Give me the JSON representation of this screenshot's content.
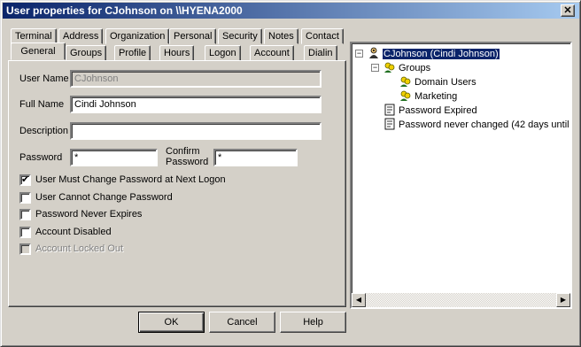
{
  "window": {
    "title": "User properties for CJohnson on \\\\HYENA2000",
    "close_glyph": "✕"
  },
  "tabs_row1": [
    "Terminal",
    "Address",
    "Organization",
    "Personal",
    "Security",
    "Notes",
    "Contact"
  ],
  "tabs_row2": [
    "General",
    "Groups",
    "Profile",
    "Hours",
    "Logon",
    "Account",
    "Dialin"
  ],
  "active_tab": "General",
  "form": {
    "user_name": {
      "label": "User Name",
      "value": "CJohnson",
      "disabled": true
    },
    "full_name": {
      "label": "Full Name",
      "value": "Cindi Johnson"
    },
    "description": {
      "label": "Description",
      "value": ""
    },
    "password": {
      "label": "Password",
      "value": "*"
    },
    "confirm_password": {
      "label_line1": "Confirm",
      "label_line2": "Password",
      "value": "*"
    }
  },
  "checkboxes": [
    {
      "label": "User Must Change Password at Next Logon",
      "checked": true,
      "disabled": false
    },
    {
      "label": "User Cannot Change Password",
      "checked": false,
      "disabled": false
    },
    {
      "label": "Password Never Expires",
      "checked": false,
      "disabled": false
    },
    {
      "label": "Account Disabled",
      "checked": false,
      "disabled": false
    },
    {
      "label": "Account Locked Out",
      "checked": false,
      "disabled": true
    }
  ],
  "tree": {
    "root": {
      "label": "CJohnson (Cindi Johnson)",
      "icon": "user-icon",
      "selected": true
    },
    "groups": {
      "label": "Groups",
      "icon": "group-icon",
      "children": [
        "Domain Users",
        "Marketing"
      ]
    },
    "info": [
      {
        "label": "Password Expired",
        "icon": "info-page-icon"
      },
      {
        "label": "Password never changed (42 days until",
        "icon": "info-page-icon"
      }
    ]
  },
  "buttons": {
    "ok": "OK",
    "cancel": "Cancel",
    "help": "Help"
  }
}
